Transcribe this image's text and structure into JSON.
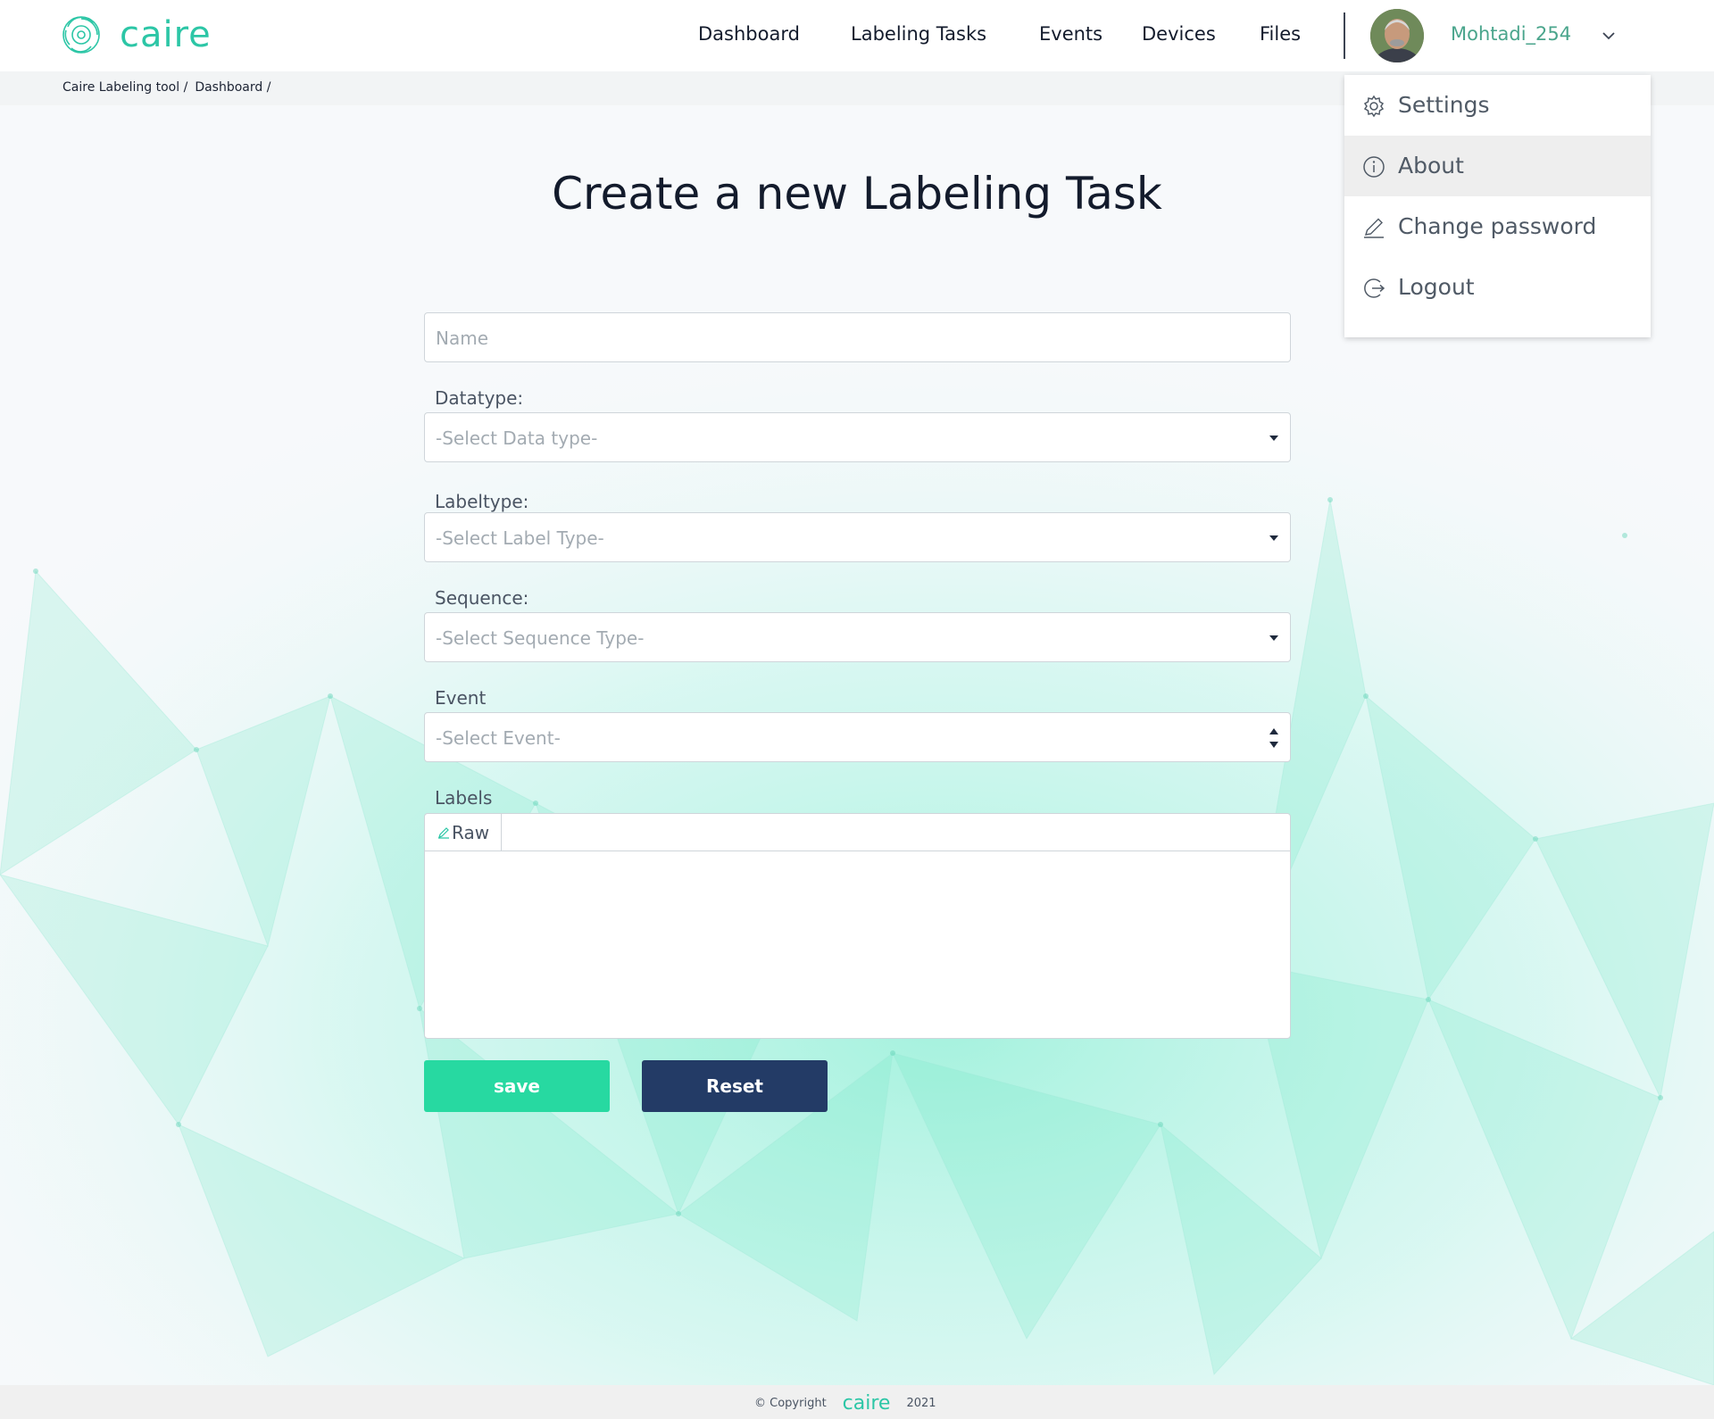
{
  "brand": {
    "name": "caire",
    "color": "#2cc6a6"
  },
  "nav": {
    "items": [
      "Dashboard",
      "Labeling Tasks",
      "Events",
      "Devices",
      "Files"
    ],
    "user": {
      "name": "Mohtadi_254"
    }
  },
  "breadcrumb": {
    "items": [
      "Caire Labeling tool /",
      "Dashboard /"
    ]
  },
  "page": {
    "title": "Create a new Labeling Task"
  },
  "form": {
    "name_placeholder": "Name",
    "datatype": {
      "label": "Datatype:",
      "placeholder": "-Select Data type-"
    },
    "labeltype": {
      "label": "Labeltype:",
      "placeholder": "-Select Label Type-"
    },
    "sequence": {
      "label": "Sequence:",
      "placeholder": "-Select Sequence Type-"
    },
    "event": {
      "label": "Event",
      "placeholder": "-Select Event-"
    },
    "labels": {
      "label": "Labels",
      "tab": "Raw",
      "value": ""
    },
    "save_label": "save",
    "reset_label": "Reset"
  },
  "user_menu": {
    "items": [
      {
        "label": "Settings",
        "icon": "gear-icon"
      },
      {
        "label": "About",
        "icon": "info-icon",
        "active": true
      },
      {
        "label": "Change password",
        "icon": "pencil-icon"
      },
      {
        "label": "Logout",
        "icon": "logout-icon"
      }
    ]
  },
  "footer": {
    "copyright": "Copyright",
    "brand": "caire",
    "year": "2021"
  },
  "colors": {
    "accent": "#27d9a1",
    "primary_dark": "#233b66",
    "username": "#4aa58c"
  }
}
